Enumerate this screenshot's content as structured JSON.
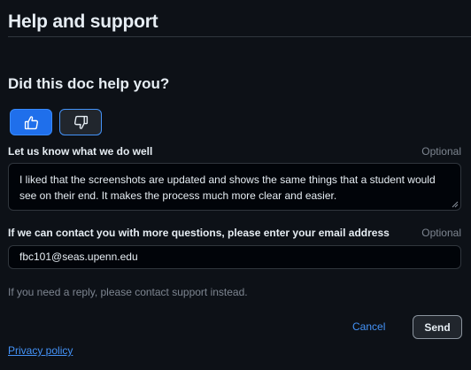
{
  "header": {
    "title": "Help and support"
  },
  "feedback": {
    "question": "Did this doc help you?",
    "thumbs_up_icon": "thumbs-up-icon",
    "thumbs_down_icon": "thumbs-down-icon",
    "selected": "thumbs-up"
  },
  "well_field": {
    "label": "Let us know what we do well",
    "optional": "Optional",
    "value": "I liked that the screenshots are updated and shows the same things that a student would see on their end. It makes the process much more clear and easier."
  },
  "email_field": {
    "label": "If we can contact you with more questions, please enter your email address",
    "optional": "Optional",
    "value": "fbc101@seas.upenn.edu"
  },
  "hint": "If you need a reply, please contact support instead.",
  "actions": {
    "cancel_label": "Cancel",
    "send_label": "Send"
  },
  "footer": {
    "privacy_label": "Privacy policy"
  },
  "colors": {
    "background": "#0d1117",
    "accent": "#1f6feb",
    "link": "#4493f8",
    "muted": "#7d8590"
  }
}
